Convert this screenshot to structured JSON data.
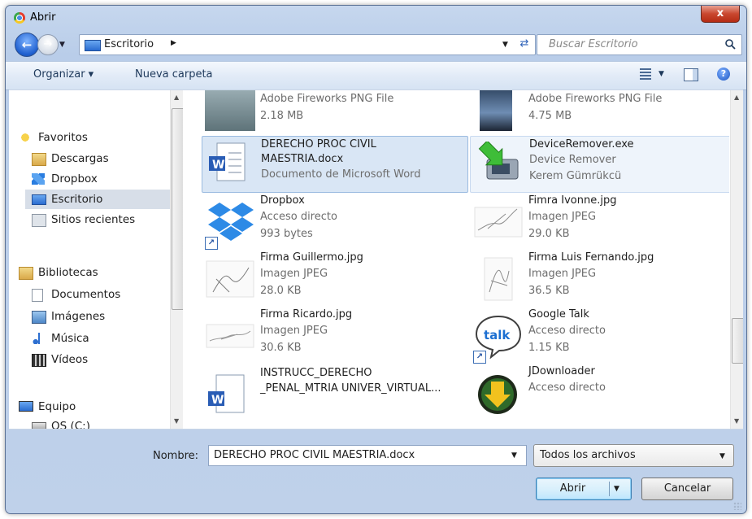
{
  "window": {
    "title": "Abrir",
    "close_label": "x"
  },
  "navigation": {
    "address_location": "Escritorio",
    "search_placeholder": "Buscar Escritorio"
  },
  "toolbar": {
    "organize_label": "Organizar ▾",
    "new_folder_label": "Nueva carpeta"
  },
  "sidebar": {
    "favorites": {
      "label": "Favoritos",
      "items": [
        "Descargas",
        "Dropbox",
        "Escritorio",
        "Sitios recientes"
      ],
      "selected": "Escritorio"
    },
    "libraries": {
      "label": "Bibliotecas",
      "items": [
        "Documentos",
        "Imágenes",
        "Música",
        "Vídeos"
      ]
    },
    "computer": {
      "label": "Equipo",
      "items": [
        "OS (C:)"
      ]
    }
  },
  "files": [
    {
      "name": "",
      "type": "Adobe Fireworks PNG File",
      "detail": "2.18 MB",
      "icon": "fireworks-png-thumbnail"
    },
    {
      "name": "",
      "type": "Adobe Fireworks PNG File",
      "detail": "4.75 MB",
      "icon": "fireworks-png-thumbnail"
    },
    {
      "name": "DERECHO PROC CIVIL MAESTRIA.docx",
      "name_line1": "DERECHO PROC CIVIL",
      "name_line2": "MAESTRIA.docx",
      "type": "Documento de Microsoft Word",
      "icon": "word-document-icon",
      "selected": true
    },
    {
      "name": "DeviceRemover.exe",
      "type": "Device Remover",
      "detail": "Kerem Gümrükcü",
      "icon": "device-remover-icon"
    },
    {
      "name": "Dropbox",
      "type": "Acceso directo",
      "detail": "993 bytes",
      "icon": "dropbox-icon"
    },
    {
      "name": "Fimra Ivonne.jpg",
      "type": "Imagen JPEG",
      "detail": "29.0 KB",
      "icon": "signature-thumbnail"
    },
    {
      "name": "Firma Guillermo.jpg",
      "type": "Imagen JPEG",
      "detail": "28.0 KB",
      "icon": "signature-thumbnail"
    },
    {
      "name": "Firma Luis Fernando.jpg",
      "type": "Imagen JPEG",
      "detail": "36.5 KB",
      "icon": "signature-thumbnail"
    },
    {
      "name": "Firma Ricardo.jpg",
      "type": "Imagen JPEG",
      "detail": "30.6 KB",
      "icon": "signature-thumbnail"
    },
    {
      "name": "Google Talk",
      "type": "Acceso directo",
      "detail": "1.15 KB",
      "icon": "google-talk-icon"
    },
    {
      "name_line1": "INSTRUCC_DERECHO",
      "name_line2": "_PENAL_MTRIA UNIVER_VIRTUAL...",
      "icon": "word-document-icon"
    },
    {
      "name": "JDownloader",
      "type": "Acceso directo",
      "icon": "jdownloader-icon"
    }
  ],
  "footer": {
    "name_label": "Nombre:",
    "name_value": "DERECHO PROC CIVIL MAESTRIA.docx",
    "filter_value": "Todos los archivos",
    "open_label": "Abrir",
    "cancel_label": "Cancelar"
  },
  "colors": {
    "selection": "#d9e6f5",
    "title_gradient": "#c6d7ee",
    "close": "#c9472f"
  }
}
